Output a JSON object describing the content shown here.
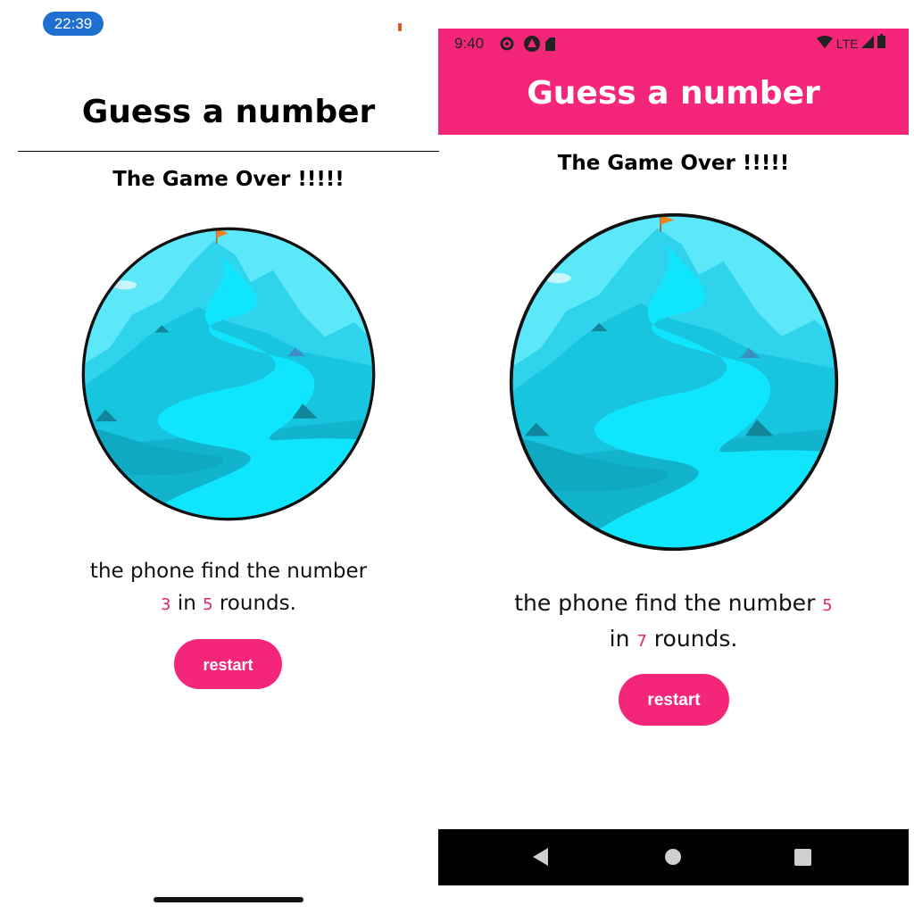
{
  "ios": {
    "status_time": "22:39",
    "header_title": "Guess a number",
    "game_over_text": "The Game Over !!!!!",
    "summary": {
      "line1": "the phone find the number",
      "number": "3",
      "in_word": "in",
      "rounds": "5",
      "rounds_word": "rounds."
    },
    "restart_label": "restart"
  },
  "android": {
    "status_time": "9:40",
    "network_label": "LTE",
    "header_title": "Guess a number",
    "game_over_text": "The Game Over !!!!!",
    "summary": {
      "line1": "the phone find the number",
      "number": "5",
      "in_word": "in",
      "rounds": "7",
      "rounds_word": "rounds."
    },
    "restart_label": "restart"
  },
  "colors": {
    "accent": "#f4267a",
    "highlight": "#e0236f",
    "ios_time_pill": "#1f6fd1",
    "lake": "#5ce8f8",
    "mountain": "#17c6de",
    "river": "#0fe6fd"
  },
  "icons": [
    "settings-gear-icon",
    "app-logo-icon",
    "sd-card-icon",
    "wifi-icon",
    "signal-icon",
    "battery-icon",
    "back-icon",
    "home-icon",
    "recents-icon",
    "flag-icon"
  ]
}
